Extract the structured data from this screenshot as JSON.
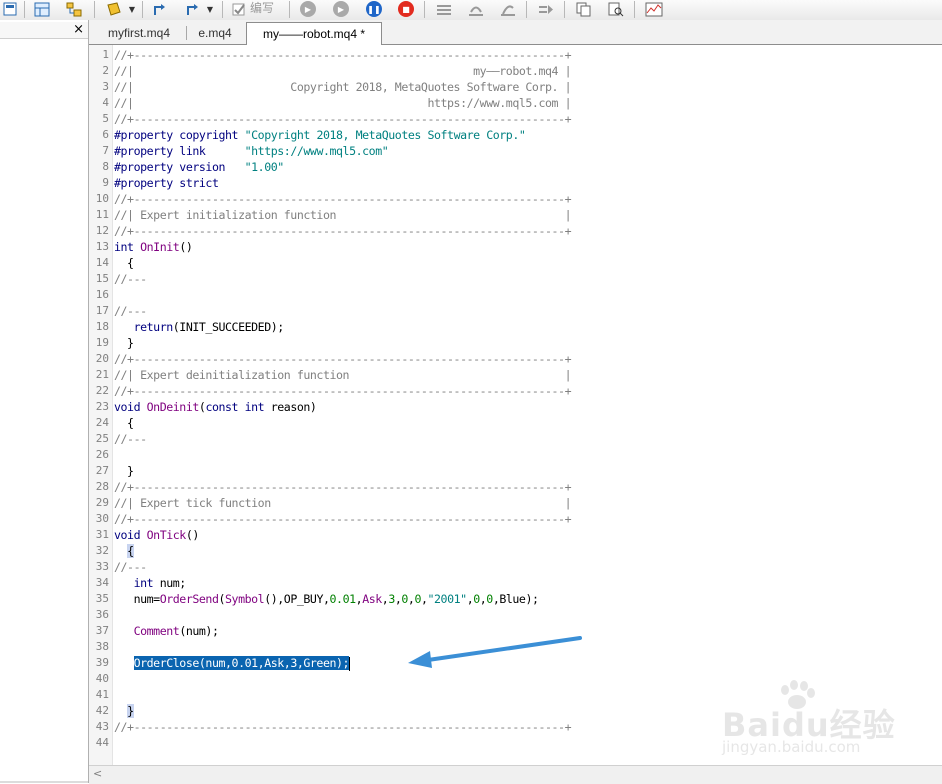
{
  "toolbar": {
    "disabled_text": "编写"
  },
  "tabs": [
    {
      "label": "myfirst.mq4"
    },
    {
      "label": "e.mq4"
    },
    {
      "label": "my——robot.mq4 *"
    }
  ],
  "watermark": {
    "brand": "Baidu经验",
    "url": "jingyan.baidu.com"
  },
  "colors": {
    "selection": "#0a64b0",
    "arrow": "#3b8fd6"
  }
}
